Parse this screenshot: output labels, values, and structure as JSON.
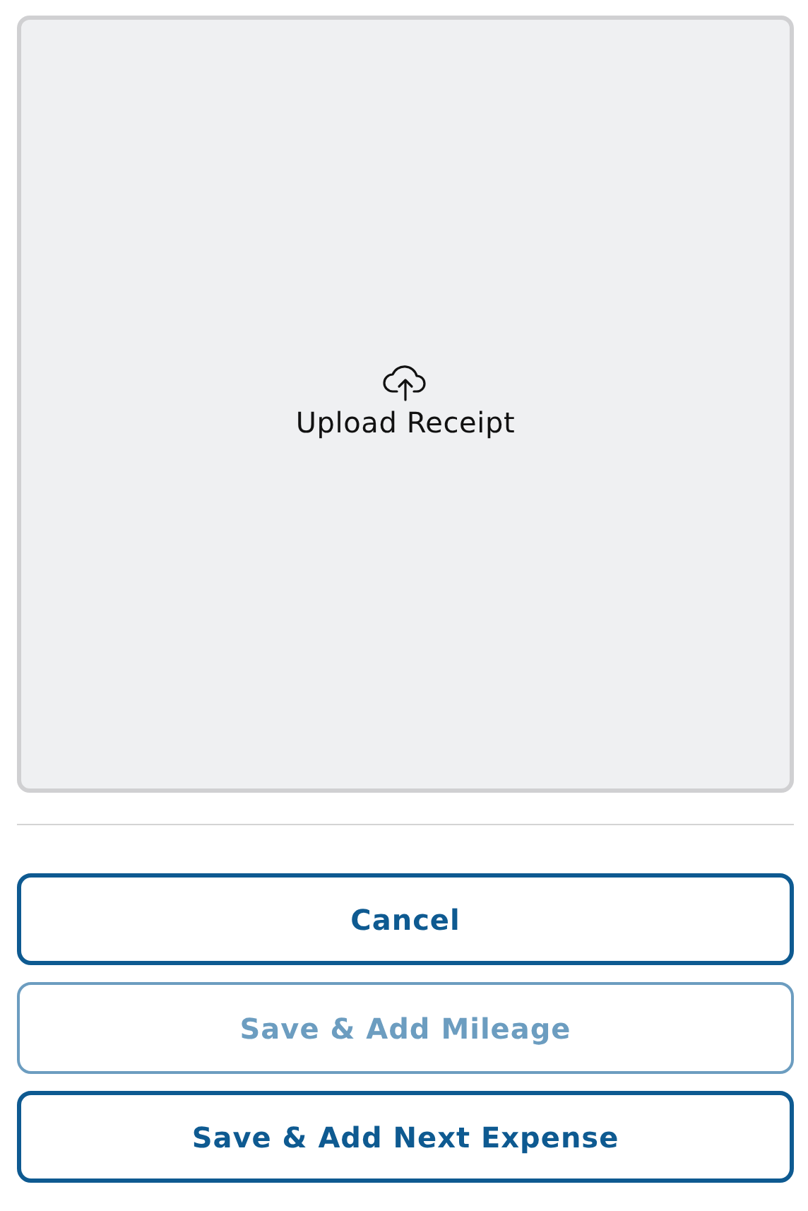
{
  "upload": {
    "label": "Upload Receipt"
  },
  "buttons": [
    {
      "label": "Cancel",
      "disabled": false
    },
    {
      "label": "Save & Add Mileage",
      "disabled": true
    },
    {
      "label": "Save & Add Next Expense",
      "disabled": false
    }
  ]
}
